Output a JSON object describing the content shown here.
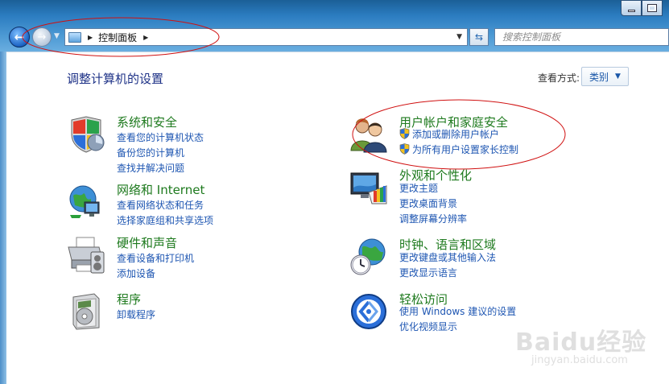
{
  "window": {
    "controls": {
      "minimize": "",
      "maximize": "",
      "close": ""
    }
  },
  "address": {
    "crumb": "控制面板"
  },
  "search": {
    "placeholder": "搜索控制面板"
  },
  "header": {
    "title": "调整计算机的设置",
    "view_label": "查看方式:",
    "view_value": "类别"
  },
  "categories": [
    {
      "title": "系统和安全",
      "links": [
        "查看您的计算机状态",
        "备份您的计算机",
        "查找并解决问题"
      ]
    },
    {
      "title": "网络和 Internet",
      "links": [
        "查看网络状态和任务",
        "选择家庭组和共享选项"
      ]
    },
    {
      "title": "硬件和声音",
      "links": [
        "查看设备和打印机",
        "添加设备"
      ]
    },
    {
      "title": "程序",
      "links": [
        "卸载程序"
      ]
    },
    {
      "title": "用户帐户和家庭安全",
      "links": [
        "添加或删除用户帐户",
        "为所有用户设置家长控制"
      ]
    },
    {
      "title": "外观和个性化",
      "links": [
        "更改主题",
        "更改桌面背景",
        "调整屏幕分辨率"
      ]
    },
    {
      "title": "时钟、语言和区域",
      "links": [
        "更改键盘或其他输入法",
        "更改显示语言"
      ]
    },
    {
      "title": "轻松访问",
      "links": [
        "使用 Windows 建议的设置",
        "优化视频显示"
      ]
    }
  ],
  "colors": {
    "category_title": "#1e7a1e",
    "link": "#1e56b2",
    "page_title": "#1e3287",
    "annotation": "#d01010"
  },
  "watermark": {
    "text": "Baidu经验",
    "sub": "jingyan.baidu.com"
  }
}
